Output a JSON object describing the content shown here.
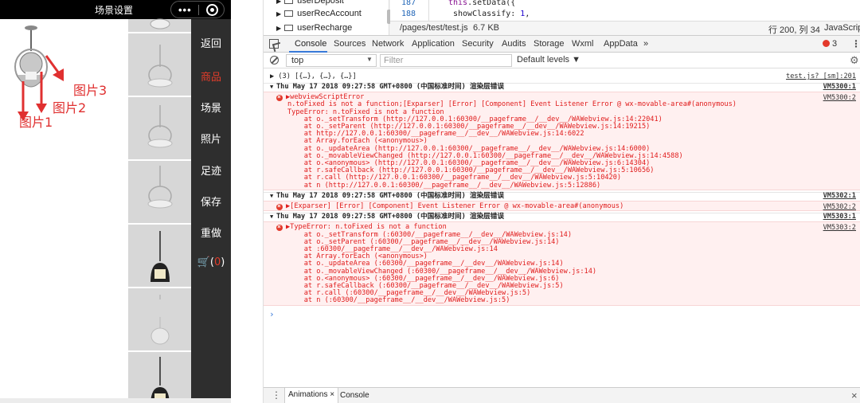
{
  "simulator": {
    "title": "场景设置",
    "capsule_more": "•••",
    "menu": [
      {
        "label": "返回",
        "active": false
      },
      {
        "label": "商品",
        "active": true
      },
      {
        "label": "场景",
        "active": false
      },
      {
        "label": "照片",
        "active": false
      },
      {
        "label": "足迹",
        "active": false
      },
      {
        "label": "保存",
        "active": false
      },
      {
        "label": "重做",
        "active": false
      }
    ],
    "cart_prefix": "🛒(",
    "cart_count": "0",
    "cart_suffix": ")",
    "annotations": [
      "图片1",
      "图片2",
      "图片3"
    ],
    "annotation_color": "#e03030"
  },
  "devtools": {
    "file_tree": [
      "userDeposit",
      "userRecAccount",
      "userRecharge"
    ],
    "code": [
      {
        "line": "187",
        "text_kw": "this",
        "text": ".setData({"
      },
      {
        "line": "188",
        "text_kw": "",
        "text": "showClassify: ",
        "num": "1",
        "tail": ","
      }
    ],
    "source_status": {
      "path": "/pages/test/test.js",
      "size": "6.7 KB",
      "position": "行 200, 列 34",
      "language": "JavaScript"
    },
    "tabs": [
      "Console",
      "Sources",
      "Network",
      "Application",
      "Security",
      "Audits",
      "Storage",
      "Wxml",
      "AppData",
      "»"
    ],
    "active_tab": "Console",
    "error_count": "3",
    "filter": {
      "context": "top",
      "placeholder": "Filter",
      "levels": "Default levels ▼"
    },
    "console": {
      "first_row": {
        "text": "▶ (3) [{…}, {…}, {…}]",
        "source": "test.js? [sm]:201"
      },
      "groups": [
        {
          "header": "Thu May 17 2018 09:27:58 GMT+0800 (中国标准时间) 渲染层错误",
          "header_source": "VM5300:1",
          "error_source": "VM5300:2",
          "lines": [
            "▶webviewScriptError",
            "n.toFixed is not a function;[Exparser] [Error] [Component] Event Listener Error @ wx-movable-area#(anonymous)",
            "TypeError: n.toFixed is not a function",
            "    at o._setTransform (http://127.0.0.1:60300/__pageframe__/__dev__/WAWebview.js:14:22041)",
            "    at o._setParent (http://127.0.0.1:60300/__pageframe__/__dev__/WAWebview.js:14:19215)",
            "    at http://127.0.0.1:60300/__pageframe__/__dev__/WAWebview.js:14:6022",
            "    at Array.forEach (<anonymous>)",
            "    at o._updateArea (http://127.0.0.1:60300/__pageframe__/__dev__/WAWebview.js:14:6000)",
            "    at o._movableViewChanged (http://127.0.0.1:60300/__pageframe__/__dev__/WAWebview.js:14:4588)",
            "    at o.<anonymous> (http://127.0.0.1:60300/__pageframe__/__dev__/WAWebview.js:6:14304)",
            "    at r.safeCallback (http://127.0.0.1:60300/__pageframe__/__dev__/WAWebview.js:5:10656)",
            "    at r.call (http://127.0.0.1:60300/__pageframe__/__dev__/WAWebview.js:5:10420)",
            "    at n (http://127.0.0.1:60300/__pageframe__/__dev__/WAWebview.js:5:12886)"
          ]
        },
        {
          "header": "Thu May 17 2018 09:27:58 GMT+0800 (中国标准时间) 渲染层错误",
          "header_source": "VM5302:1",
          "error_source": "VM5302:2",
          "lines": [
            "▶[Exparser] [Error] [Component] Event Listener Error @ wx-movable-area#(anonymous)"
          ]
        },
        {
          "header": "Thu May 17 2018 09:27:58 GMT+0800 (中国标准时间) 渲染层错误",
          "header_source": "VM5303:1",
          "error_source": "VM5303:2",
          "lines": [
            "▶TypeError: n.toFixed is not a function",
            "    at o._setTransform (:60300/__pageframe__/__dev__/WAWebview.js:14)",
            "    at o._setParent (:60300/__pageframe__/__dev__/WAWebview.js:14)",
            "    at :60300/__pageframe__/__dev__/WAWebview.js:14",
            "    at Array.forEach (<anonymous>)",
            "    at o._updateArea (:60300/__pageframe__/__dev__/WAWebview.js:14)",
            "    at o._movableViewChanged (:60300/__pageframe__/__dev__/WAWebview.js:14)",
            "    at o.<anonymous> (:60300/__pageframe__/__dev__/WAWebview.js:6)",
            "    at r.safeCallback (:60300/__pageframe__/__dev__/WAWebview.js:5)",
            "    at r.call (:60300/__pageframe__/__dev__/WAWebview.js:5)",
            "    at n (:60300/__pageframe__/__dev__/WAWebview.js:5)"
          ]
        }
      ],
      "prompt": "›"
    },
    "drawer": {
      "tab1": "Animations ×",
      "tab2": "Console",
      "close": "×",
      "menu": "⋮"
    },
    "colors": {
      "error": "#e01b1b",
      "error_bg": "#fff0f0",
      "accent": "#3879d9",
      "active_menu": "#e23c2a"
    }
  }
}
